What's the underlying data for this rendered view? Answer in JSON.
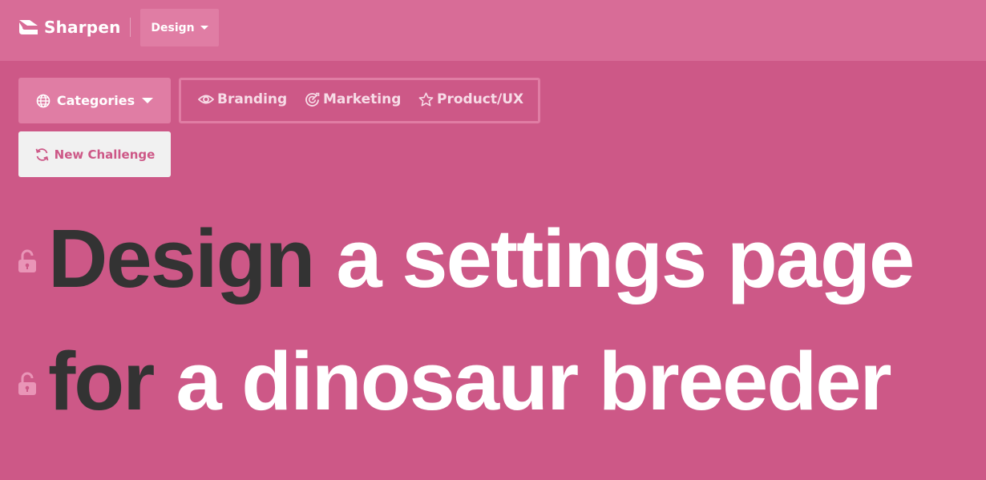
{
  "header": {
    "brand": "Sharpen",
    "mode_dropdown": "Design"
  },
  "filters": {
    "categories_label": "Categories",
    "items": [
      {
        "label": "Branding",
        "icon": "eye-icon"
      },
      {
        "label": "Marketing",
        "icon": "target-icon"
      },
      {
        "label": "Product/UX",
        "icon": "star-icon"
      }
    ]
  },
  "actions": {
    "new_challenge": "New Challenge"
  },
  "challenge": {
    "line1": {
      "verb": "Design",
      "rest": "a settings page"
    },
    "line2": {
      "verb": "for",
      "rest": "a dinosaur breeder"
    }
  },
  "colors": {
    "background": "#cd5887",
    "header": "#d86c97",
    "button": "#e07da4",
    "dark_text": "#333333"
  }
}
